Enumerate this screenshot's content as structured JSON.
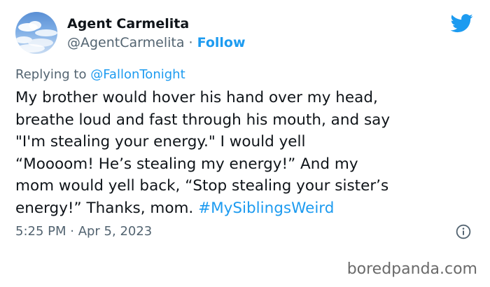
{
  "tweet": {
    "display_name": "Agent Carmelita",
    "handle": "@AgentCarmelita",
    "separator": "·",
    "follow_label": "Follow",
    "reply_prefix": "Replying to",
    "reply_to": "@FallonTonight",
    "body_lines": [
      "My brother would hover his hand over my head,",
      "breathe loud and fast through his mouth, and say",
      "\"I'm stealing your energy.\"  I would yell",
      "“Moooom! He’s stealing my energy!” And my",
      "mom would yell back, “Stop stealing your sister’s"
    ],
    "body_last_line_text": "energy!”  Thanks, mom. ",
    "hashtag": "#MySiblingsWeird",
    "timestamp": "5:25 PM · Apr 5, 2023"
  },
  "icons": {
    "brand": "twitter-bird-icon",
    "info": "info-icon"
  },
  "colors": {
    "accent": "#1d9bf0",
    "secondary_text": "#536471",
    "primary_text": "#0f1419"
  },
  "watermark": "boredpanda.com"
}
